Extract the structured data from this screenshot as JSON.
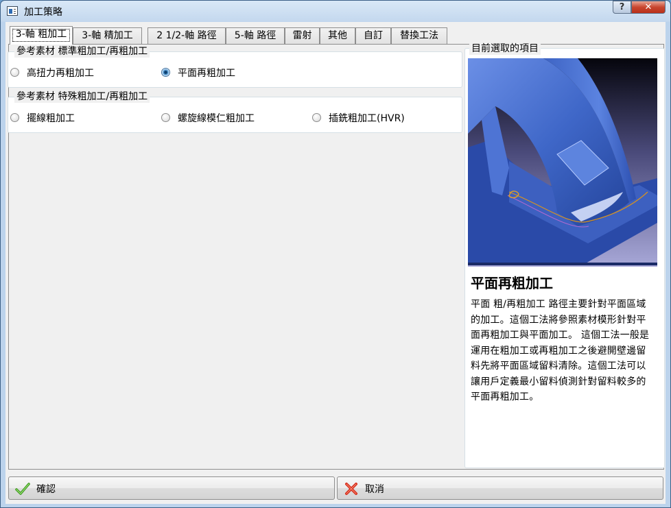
{
  "window": {
    "title": "加工策略",
    "help_label": "?",
    "close_label": "✕"
  },
  "tabs": [
    {
      "label": "3-軸 粗加工"
    },
    {
      "label": "3-軸 精加工"
    },
    {
      "label": "2 1/2-軸 路徑"
    },
    {
      "label": "5-軸 路徑"
    },
    {
      "label": "雷射"
    },
    {
      "label": "其他"
    },
    {
      "label": "自訂"
    },
    {
      "label": "替換工法"
    }
  ],
  "groups": {
    "standard": {
      "title": "參考素材 標準粗加工/再粗加工",
      "options": [
        {
          "label": "高扭力再粗加工",
          "selected": false
        },
        {
          "label": "平面再粗加工",
          "selected": true
        }
      ]
    },
    "special": {
      "title": "參考素材 特殊粗加工/再粗加工",
      "options": [
        {
          "label": "擺線粗加工",
          "selected": false
        },
        {
          "label": "螺旋線模仁粗加工",
          "selected": false
        },
        {
          "label": "插銑粗加工(HVR)",
          "selected": false
        }
      ]
    }
  },
  "preview": {
    "legend": "目前選取的項目",
    "title": "平面再粗加工",
    "description_lines": [
      "平面 粗/再粗加工 路徑主要針對平面區域",
      "的加工。這個工法將參照素材模形針對平",
      "面再粗加工與平面加工。 這個工法一般是",
      "運用在粗加工或再粗加工之後避開壁邊留",
      "料先將平面區域留料清除。這個工法可以",
      "讓用戶定義最小留料偵測針對留料較多的",
      "平面再粗加工。"
    ]
  },
  "buttons": {
    "ok_label": "確認",
    "cancel_label": "取消"
  },
  "colors": {
    "model_blue": "#3f67c8",
    "toolpath_orange": "#d9931e",
    "accept_green": "#3c9a1e",
    "cancel_red": "#d52a1a"
  }
}
